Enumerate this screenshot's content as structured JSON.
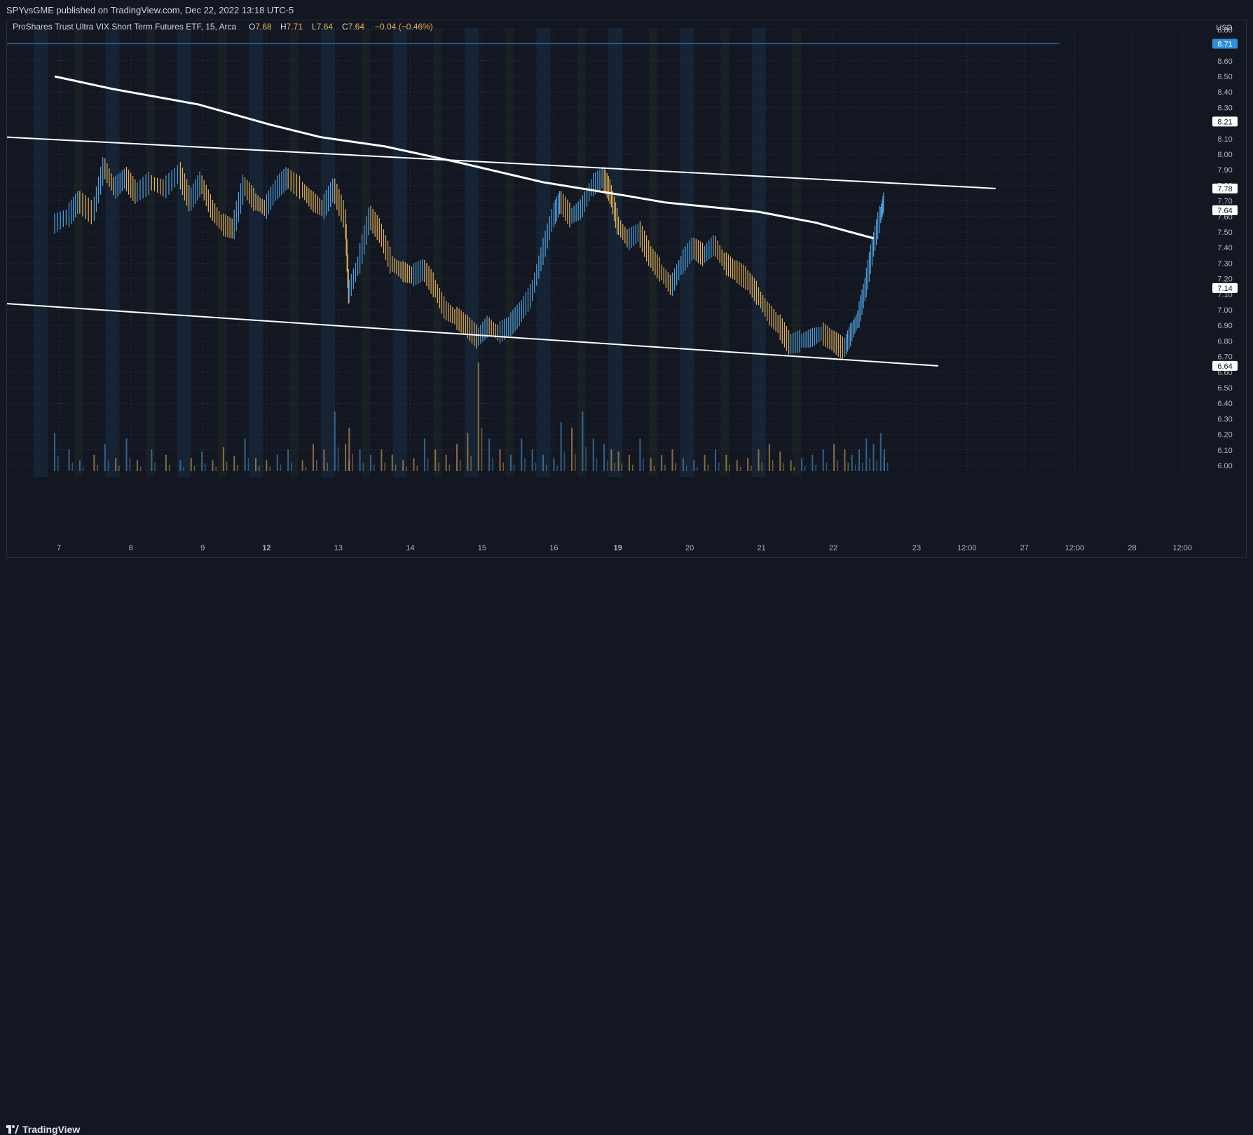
{
  "header": {
    "publish_line": "SPYvsGME published on TradingView.com, Dec 22, 2022 13:18 UTC-5"
  },
  "legend": {
    "symbol": "ProShares Trust Ultra VIX Short Term Futures ETF, 15, Arca",
    "o_label": "O",
    "o_value": "7.68",
    "h_label": "H",
    "h_value": "7.71",
    "l_label": "L",
    "l_value": "7.64",
    "c_label": "C",
    "c_value": "7.64",
    "change": "−0.04 (−0.46%)"
  },
  "footer": {
    "brand": "TradingView"
  },
  "colors": {
    "background": "#131722",
    "session_band": "#1c3a55",
    "up_bar": "#4fa3e0",
    "down_bar": "#e3b25a",
    "trendline": "#ffffff",
    "hline": "#2f8fdb",
    "grid": "#26313b",
    "axis_text": "#b2b5be"
  },
  "chart_data": {
    "type": "bar",
    "title": "ProShares Trust Ultra VIX Short Term Futures ETF, 15, Arca",
    "currency": "USD",
    "ylim": [
      6.0,
      8.8
    ],
    "y_ticks": [
      "8.80",
      "8.71",
      "8.60",
      "8.50",
      "8.40",
      "8.30",
      "8.21",
      "8.10",
      "8.00",
      "7.90",
      "7.80",
      "7.78",
      "7.70",
      "7.64",
      "7.60",
      "7.50",
      "7.40",
      "7.30",
      "7.20",
      "7.14",
      "7.10",
      "7.00",
      "6.90",
      "6.80",
      "6.70",
      "6.64",
      "6.60",
      "6.50",
      "6.40",
      "6.30",
      "6.20",
      "6.10",
      "6.00"
    ],
    "y_ticks_plain": [
      "8.80",
      "8.60",
      "8.50",
      "8.40",
      "8.30",
      "8.10",
      "8.00",
      "7.90",
      "7.80",
      "7.70",
      "7.60",
      "7.50",
      "7.40",
      "7.30",
      "7.20",
      "7.10",
      "7.00",
      "6.90",
      "6.80",
      "6.70",
      "6.60",
      "6.50",
      "6.40",
      "6.30",
      "6.20",
      "6.10",
      "6.00"
    ],
    "price_labels": [
      {
        "value": 8.71,
        "text": "8.71",
        "style": "blue"
      },
      {
        "value": 8.21,
        "text": "8.21",
        "style": "white"
      },
      {
        "value": 7.78,
        "text": "7.78",
        "style": "white"
      },
      {
        "value": 7.64,
        "text": "7.64",
        "style": "white"
      },
      {
        "value": 7.14,
        "text": "7.14",
        "style": "white"
      },
      {
        "value": 6.64,
        "text": "6.64",
        "style": "white"
      }
    ],
    "horizontal_line": 8.71,
    "x_labels": [
      {
        "t": 0.06,
        "text": "7",
        "bold": false
      },
      {
        "t": 1.06,
        "text": "8",
        "bold": false
      },
      {
        "t": 2.06,
        "text": "9",
        "bold": false
      },
      {
        "t": 2.95,
        "text": "12",
        "bold": true
      },
      {
        "t": 3.95,
        "text": "13",
        "bold": false
      },
      {
        "t": 4.95,
        "text": "14",
        "bold": false
      },
      {
        "t": 5.95,
        "text": "15",
        "bold": false
      },
      {
        "t": 6.95,
        "text": "16",
        "bold": false
      },
      {
        "t": 7.84,
        "text": "19",
        "bold": true
      },
      {
        "t": 8.84,
        "text": "20",
        "bold": false
      },
      {
        "t": 9.84,
        "text": "21",
        "bold": false
      },
      {
        "t": 10.84,
        "text": "22",
        "bold": false
      },
      {
        "t": 12.0,
        "text": "23",
        "bold": false
      },
      {
        "t": 12.7,
        "text": "12:00",
        "bold": false
      },
      {
        "t": 13.5,
        "text": "27",
        "bold": false
      },
      {
        "t": 14.2,
        "text": "12:00",
        "bold": false
      },
      {
        "t": 15.0,
        "text": "28",
        "bold": false
      },
      {
        "t": 15.7,
        "text": "12:00",
        "bold": false
      }
    ],
    "series": [
      {
        "name": "Price",
        "points": [
          [
            0.0,
            7.55
          ],
          [
            0.2,
            7.6
          ],
          [
            0.35,
            7.7
          ],
          [
            0.55,
            7.62
          ],
          [
            0.7,
            7.92
          ],
          [
            0.85,
            7.78
          ],
          [
            1.0,
            7.85
          ],
          [
            1.15,
            7.75
          ],
          [
            1.35,
            7.82
          ],
          [
            1.55,
            7.78
          ],
          [
            1.75,
            7.88
          ],
          [
            1.9,
            7.7
          ],
          [
            2.05,
            7.82
          ],
          [
            2.2,
            7.65
          ],
          [
            2.35,
            7.55
          ],
          [
            2.5,
            7.52
          ],
          [
            2.65,
            7.8
          ],
          [
            2.8,
            7.7
          ],
          [
            2.95,
            7.65
          ],
          [
            3.1,
            7.78
          ],
          [
            3.25,
            7.85
          ],
          [
            3.45,
            7.78
          ],
          [
            3.6,
            7.7
          ],
          [
            3.75,
            7.65
          ],
          [
            3.9,
            7.78
          ],
          [
            4.05,
            7.6
          ],
          [
            4.1,
            7.1
          ],
          [
            4.25,
            7.3
          ],
          [
            4.4,
            7.6
          ],
          [
            4.55,
            7.5
          ],
          [
            4.7,
            7.3
          ],
          [
            4.85,
            7.25
          ],
          [
            5.0,
            7.22
          ],
          [
            5.15,
            7.26
          ],
          [
            5.3,
            7.15
          ],
          [
            5.45,
            7.0
          ],
          [
            5.6,
            6.95
          ],
          [
            5.75,
            6.9
          ],
          [
            5.9,
            6.82
          ],
          [
            6.05,
            6.9
          ],
          [
            6.2,
            6.85
          ],
          [
            6.35,
            6.9
          ],
          [
            6.5,
            6.98
          ],
          [
            6.65,
            7.1
          ],
          [
            6.8,
            7.35
          ],
          [
            6.95,
            7.6
          ],
          [
            7.05,
            7.7
          ],
          [
            7.2,
            7.6
          ],
          [
            7.35,
            7.65
          ],
          [
            7.5,
            7.8
          ],
          [
            7.65,
            7.85
          ],
          [
            7.75,
            7.75
          ],
          [
            7.85,
            7.55
          ],
          [
            8.0,
            7.45
          ],
          [
            8.15,
            7.5
          ],
          [
            8.3,
            7.35
          ],
          [
            8.45,
            7.25
          ],
          [
            8.6,
            7.15
          ],
          [
            8.75,
            7.3
          ],
          [
            8.9,
            7.4
          ],
          [
            9.05,
            7.35
          ],
          [
            9.2,
            7.42
          ],
          [
            9.35,
            7.3
          ],
          [
            9.5,
            7.25
          ],
          [
            9.65,
            7.2
          ],
          [
            9.8,
            7.1
          ],
          [
            9.95,
            6.98
          ],
          [
            10.1,
            6.9
          ],
          [
            10.25,
            6.78
          ],
          [
            10.4,
            6.8
          ],
          [
            10.55,
            6.82
          ],
          [
            10.7,
            6.85
          ],
          [
            10.85,
            6.8
          ],
          [
            11.0,
            6.75
          ],
          [
            11.1,
            6.85
          ],
          [
            11.2,
            6.95
          ],
          [
            11.3,
            7.15
          ],
          [
            11.4,
            7.4
          ],
          [
            11.5,
            7.6
          ],
          [
            11.55,
            7.7
          ]
        ]
      }
    ],
    "trendlines": [
      {
        "name": "upper",
        "from": [
          0.0,
          8.11
        ],
        "to": [
          13.1,
          7.78
        ]
      },
      {
        "name": "lower",
        "from": [
          0.0,
          7.04
        ],
        "to": [
          12.3,
          6.64
        ]
      }
    ],
    "moving_average": {
      "points": [
        [
          0.0,
          8.5
        ],
        [
          0.8,
          8.42
        ],
        [
          2.0,
          8.32
        ],
        [
          3.0,
          8.19
        ],
        [
          3.7,
          8.11
        ],
        [
          4.6,
          8.05
        ],
        [
          5.6,
          7.95
        ],
        [
          6.8,
          7.82
        ],
        [
          8.0,
          7.73
        ],
        [
          8.5,
          7.69
        ],
        [
          9.8,
          7.63
        ],
        [
          10.6,
          7.56
        ],
        [
          11.4,
          7.46
        ]
      ]
    },
    "volume": {
      "scale_max": 1.0,
      "values": [
        0.35,
        0.2,
        0.1,
        0.15,
        0.25,
        0.12,
        0.3,
        0.1,
        0.2,
        0.15,
        0.1,
        0.12,
        0.18,
        0.1,
        0.22,
        0.14,
        0.3,
        0.12,
        0.1,
        0.15,
        0.2,
        0.1,
        0.25,
        0.2,
        0.55,
        0.25,
        0.4,
        0.2,
        0.15,
        0.2,
        0.15,
        0.1,
        0.12,
        0.3,
        0.2,
        0.15,
        0.25,
        0.35,
        1.0,
        0.3,
        0.2,
        0.15,
        0.3,
        0.2,
        0.15,
        0.12,
        0.45,
        0.4,
        0.55,
        0.3,
        0.25,
        0.2,
        0.18,
        0.15,
        0.3,
        0.12,
        0.15,
        0.2,
        0.12,
        0.1,
        0.15,
        0.2,
        0.15,
        0.1,
        0.12,
        0.2,
        0.25,
        0.18,
        0.1,
        0.12,
        0.15,
        0.2,
        0.25,
        0.2,
        0.15,
        0.2,
        0.3,
        0.25,
        0.35,
        0.2
      ]
    },
    "xlabel": "",
    "ylabel": "",
    "grid": true
  }
}
